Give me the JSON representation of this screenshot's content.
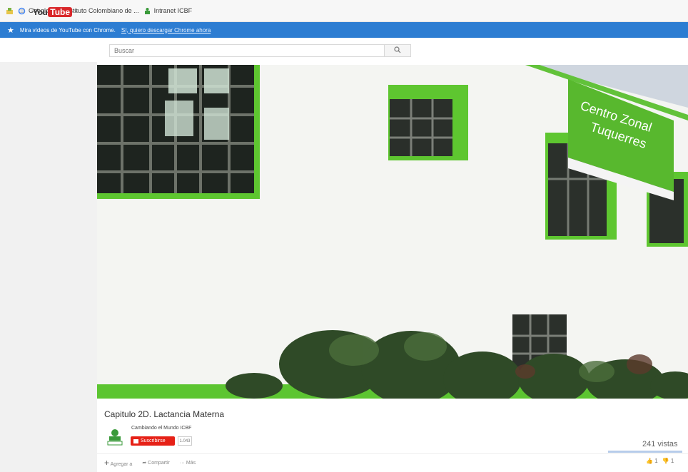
{
  "bookmarks": [
    {
      "label": "Google",
      "icon": "google-icon"
    },
    {
      "label": "Instituto Colombiano de ...",
      "icon": "icbf-icon"
    },
    {
      "label": "Intranet ICBF",
      "icon": "icbf-icon"
    }
  ],
  "promo": {
    "text": "Mira vídeos de YouTube con Chrome.",
    "link": "Sí, quiero descargar Chrome ahora"
  },
  "search": {
    "placeholder": "Buscar"
  },
  "video": {
    "sign_line1": "Centro Zonal",
    "sign_line2": "Tuquerres"
  },
  "info": {
    "title": "Capitulo 2D. Lactancia Materna",
    "channel": "Cambiando el Mundo ICBF",
    "subscribe_label": "Suscribirse",
    "sub_count": "1.043",
    "views": "241 vistas",
    "add_label": "Agregar a",
    "share_label": "Compartir",
    "more_label": "Más",
    "like_count": "1",
    "dislike_count": "1"
  },
  "colors": {
    "promo": "#2d7dd2",
    "subscribe": "#e62117",
    "wall_green": "#5cc531"
  }
}
